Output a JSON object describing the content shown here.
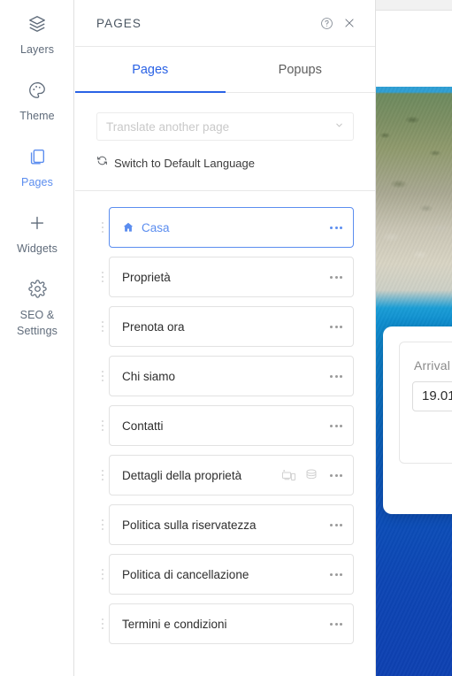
{
  "rail": {
    "items": [
      {
        "label": "Layers",
        "icon": "layers-icon",
        "active": false
      },
      {
        "label": "Theme",
        "icon": "palette-icon",
        "active": false
      },
      {
        "label": "Pages",
        "icon": "pages-icon",
        "active": true
      },
      {
        "label": "Widgets",
        "icon": "plus-icon",
        "active": false
      },
      {
        "label": "SEO & Settings",
        "icon": "gear-icon",
        "active": false
      }
    ]
  },
  "panel": {
    "title": "PAGES",
    "help_icon": "help-circle-icon",
    "close_icon": "close-icon",
    "tabs": [
      {
        "label": "Pages",
        "active": true
      },
      {
        "label": "Popups",
        "active": false
      }
    ],
    "translate_select": {
      "placeholder": "Translate another page",
      "value": "",
      "chevron_icon": "chevron-down-icon"
    },
    "switch_language": {
      "label": "Switch to Default Language",
      "icon": "refresh-icon"
    },
    "pages": [
      {
        "label": "Casa",
        "selected": true,
        "home": true,
        "icons": []
      },
      {
        "label": "Proprietà",
        "selected": false,
        "home": false,
        "icons": []
      },
      {
        "label": "Prenota ora",
        "selected": false,
        "home": false,
        "icons": []
      },
      {
        "label": "Chi siamo",
        "selected": false,
        "home": false,
        "icons": []
      },
      {
        "label": "Contatti",
        "selected": false,
        "home": false,
        "icons": []
      },
      {
        "label": "Dettagli della proprietà",
        "selected": false,
        "home": false,
        "icons": [
          "dynamic-page-icon",
          "database-icon"
        ]
      },
      {
        "label": "Politica sulla riservatezza",
        "selected": false,
        "home": false,
        "icons": []
      },
      {
        "label": "Politica di cancellazione",
        "selected": false,
        "home": false,
        "icons": []
      },
      {
        "label": "Termini e condizioni",
        "selected": false,
        "home": false,
        "icons": []
      }
    ],
    "row_menu_icon": "more-options-icon"
  },
  "site_preview": {
    "booking_widget": {
      "arrival_label": "Arrival",
      "arrival_value": "19.01."
    }
  },
  "colors": {
    "accent_blue": "#5b8def",
    "tab_blue": "#2a62e5",
    "text_dark": "#2d2d2d",
    "text_muted": "#8a8a8a",
    "border": "#e2e2e2",
    "sea_blue": "#0e3fb0"
  }
}
